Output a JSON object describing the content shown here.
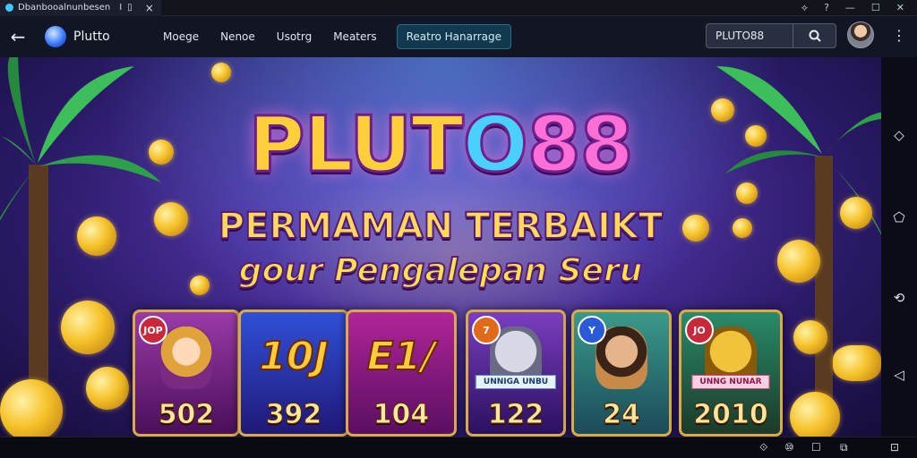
{
  "window": {
    "tab_title": "Dbanbooalnunbesen",
    "tab_separator": "I",
    "tab_close": "×",
    "controls": [
      "⟡",
      "?",
      "—",
      "☐",
      "✕"
    ]
  },
  "navbar": {
    "back_icon": "←",
    "brand": "Plutto",
    "menu": [
      "Moege",
      "Nenoe",
      "Usotrg",
      "Meaters"
    ],
    "cta": "Reatro Hanarrage",
    "search_value": "PLUTO88",
    "search_icon": "⌕",
    "kebab": "⋮"
  },
  "hero": {
    "title_part1": "PLUT",
    "title_part2": "O",
    "title_part3": "88",
    "subtitle": "PERMAMAN TERBAIKT",
    "tagline": "gour Pengalepan Seru",
    "cards": [
      {
        "badge": "JOP",
        "big": "",
        "number": "502",
        "bg1": "#9a3aa8",
        "bg2": "#4a0f5a"
      },
      {
        "badge": "",
        "big": "10J",
        "number": "392",
        "bg1": "#3050d8",
        "bg2": "#201878"
      },
      {
        "badge": "",
        "big": "E1/",
        "number": "104",
        "bg1": "#b0259a",
        "bg2": "#5a0e62"
      },
      {
        "badge": "7",
        "big": "",
        "number": "122",
        "ribbon": "UNNIGA UNBU",
        "bg1": "#7a3ec0",
        "bg2": "#2a1060"
      },
      {
        "badge": "Y",
        "big": "",
        "number": "24",
        "bg1": "#3a9a8a",
        "bg2": "#1a4a5a"
      },
      {
        "badge": "JO",
        "big": "",
        "number": "2010",
        "ribbon": "UNNG NUNAR",
        "bg1": "#2a8a6a",
        "bg2": "#1a3a2a"
      }
    ]
  },
  "sidebar_right": {
    "icons": [
      "◇",
      "⬠",
      "⟲",
      "◁"
    ]
  },
  "taskbar": {
    "icons": [
      "⟐",
      "⑩",
      "☐",
      "⧉",
      "⊡"
    ]
  },
  "colors": {
    "accent": "#ffcf3a",
    "cta_bg": "#123a4e"
  }
}
